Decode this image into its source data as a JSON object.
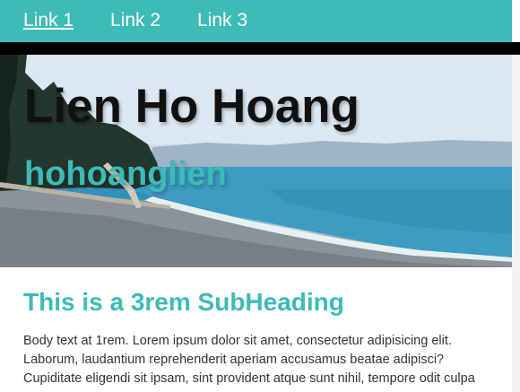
{
  "nav": {
    "links": [
      {
        "label": "Link 1",
        "active": true
      },
      {
        "label": "Link 2",
        "active": false
      },
      {
        "label": "Link 3",
        "active": false
      }
    ]
  },
  "hero": {
    "title": "Lien Ho Hoang",
    "subtitle": "hohoanglien",
    "image": "beach-coastline-photo"
  },
  "main": {
    "subheading": "This is a 3rem SubHeading",
    "body": "Body text at 1rem. Lorem ipsum dolor sit amet, consectetur adipisicing elit. Laborum, laudantium reprehenderit aperiam accusamus beatae adipisci? Cupiditate eligendi sit ipsam, sint provident atque sunt nihil, tempore odit culpa"
  },
  "colors": {
    "accent": "#3dbbb7",
    "nav_bar_strip": "#000000",
    "title": "#111111",
    "body_text": "#333333"
  }
}
